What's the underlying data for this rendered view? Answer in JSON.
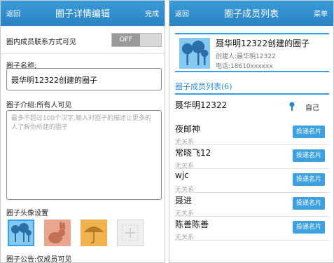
{
  "left": {
    "header": {
      "back": "返回",
      "title": "圈子详情编辑",
      "done": "完成"
    },
    "contact_visibility": {
      "label": "圈内成员联系方式可见",
      "toggle_value": "OFF"
    },
    "name": {
      "label": "圈子名称:",
      "value": "聂华明12322创建的圈子"
    },
    "intro": {
      "label": "圈子介绍:所有人可见",
      "placeholder": "最多不超过100个汉字,输入对圈子的描述让更多的人了解你所建的圈子"
    },
    "avatar": {
      "label": "圈子头像设置",
      "options": [
        "tree-avatar-icon",
        "rabbit-avatar-icon",
        "umbrella-avatar-icon",
        "add-avatar-icon"
      ]
    },
    "footer_partial": "圈子公告:仅成员可见"
  },
  "right": {
    "header": {
      "back": "返回",
      "title": "圈子成员列表",
      "menu": "菜单"
    },
    "group": {
      "name": "聂华明12322创建的圈子",
      "creator": "创建人:聂华明12322",
      "phone": "电话:18610xxxxxx"
    },
    "members_title": "圈子成员列表(6)",
    "owner": {
      "name": "聂华明12322",
      "tag": "自己"
    },
    "send_label": "投递名片",
    "members": [
      {
        "name": "夜邮神",
        "relation": "无关系"
      },
      {
        "name": "常晓飞12",
        "relation": "无关系"
      },
      {
        "name": "wjc",
        "relation": "无关系"
      },
      {
        "name": "聂进",
        "relation": "无关系"
      },
      {
        "name": "陈善陈善",
        "relation": "无关系"
      }
    ]
  },
  "colors": {
    "accent": "#2a83c4",
    "button": "#3da1e0",
    "muted": "#a9a9a9"
  }
}
